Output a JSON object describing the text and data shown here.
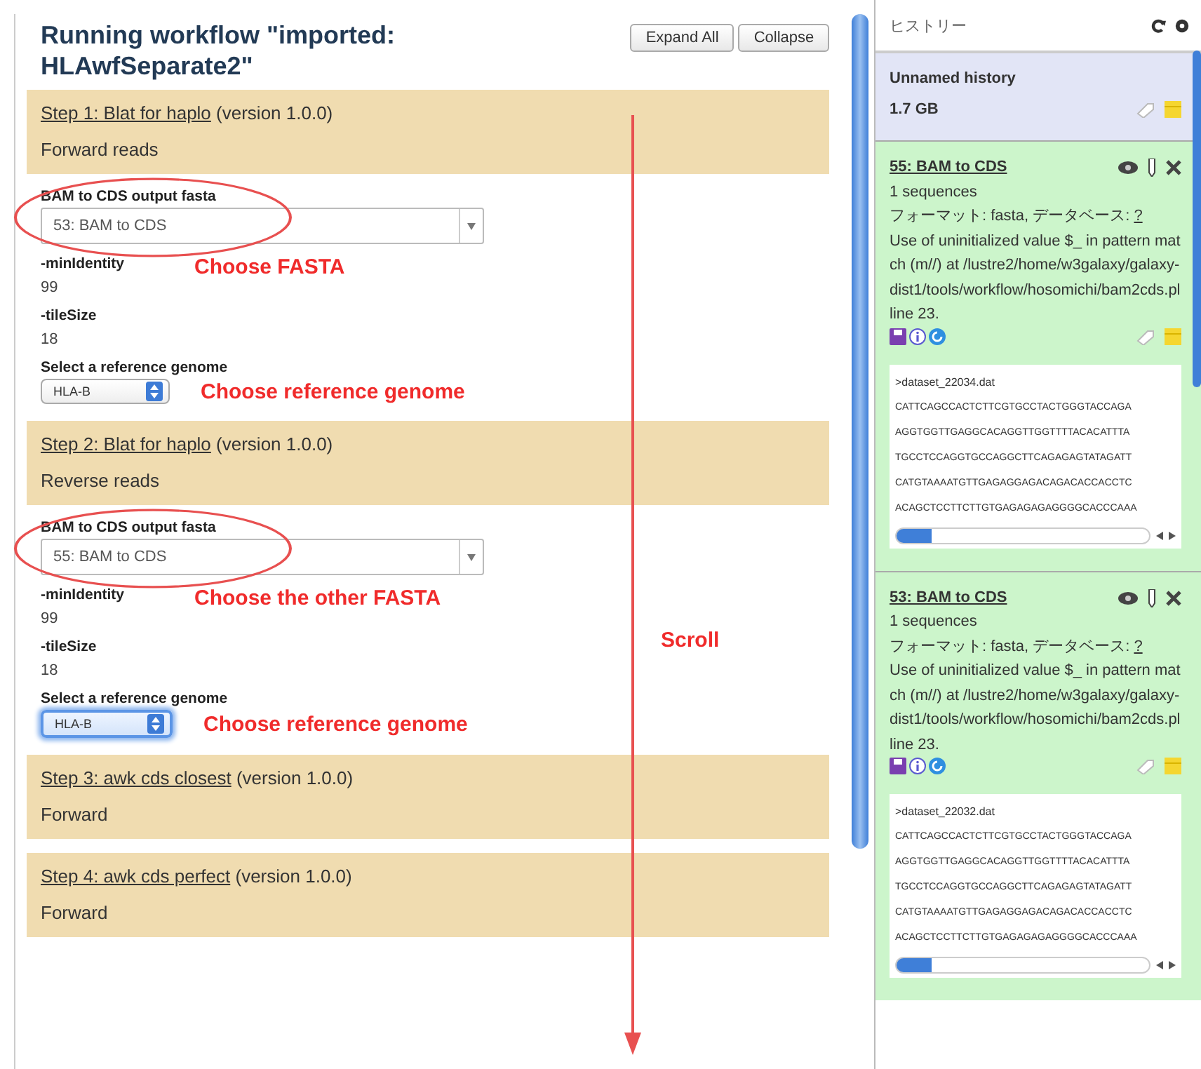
{
  "workflow": {
    "title": "Running workflow \"imported: HLAwfSeparate2\"",
    "buttons": [
      "Expand All",
      "Collapse"
    ]
  },
  "steps": [
    {
      "title": "Step 1: Blat for haplo",
      "version": "(version 1.0.0)",
      "annotation": "Forward reads",
      "data_input": {
        "label": "BAM to CDS output fasta",
        "value": "53: BAM to CDS",
        "circled": true,
        "note": "Choose FASTA"
      },
      "params": [
        {
          "label": "-minIdentity",
          "value": "99"
        },
        {
          "label": "-tileSize",
          "value": "18"
        }
      ],
      "genome": {
        "label": "Select a reference genome",
        "value": "HLA-B",
        "focused": false,
        "note": "Choose reference genome"
      }
    },
    {
      "title": "Step 2: Blat for haplo",
      "version": "(version 1.0.0)",
      "annotation": "Reverse reads",
      "data_input": {
        "label": "BAM to CDS output fasta",
        "value": "55: BAM to CDS",
        "circled": true,
        "note": "Choose the other FASTA"
      },
      "params": [
        {
          "label": "-minIdentity",
          "value": "99"
        },
        {
          "label": "-tileSize",
          "value": "18"
        }
      ],
      "genome": {
        "label": "Select a reference genome",
        "value": "HLA-B",
        "focused": true,
        "note": "Choose reference genome"
      }
    },
    {
      "title": "Step 3: awk cds closest",
      "version": "(version 1.0.0)",
      "annotation": "Forward"
    },
    {
      "title": "Step 4: awk cds perfect",
      "version": "(version 1.0.0)",
      "annotation": "Forward"
    }
  ],
  "scroll_hint": {
    "label": "Scroll"
  },
  "history": {
    "title": "ヒストリー",
    "name": "Unnamed history",
    "size": "1.7 GB",
    "datasets": [
      {
        "title": "55: BAM to CDS",
        "lines": [
          "1 sequences"
        ],
        "format": "フォーマット: fasta, データベース: ",
        "db": "?",
        "info": "Use of uninitialized value $_ in pattern match (m//) at /lustre2/home/w3galaxy/galaxy-dist1/tools/workflow/hosomichi/bam2cds.pl line 23.",
        "peek": [
          ">dataset_22034.dat",
          "CATTCAGCCACTCTTCGTGCCTACTGGGTACCAGA",
          "AGGTGGTTGAGGCACAGGTTGGTTTTACACATTTA",
          "TGCCTCCAGGTGCCAGGCTTCAGAGAGTATAGATT",
          "CATGTAAAATGTTGAGAGGAGACAGACACCACCTC",
          "ACAGCTCCTTCTTGTGAGAGAGAGGGGCACCCAAA"
        ]
      },
      {
        "title": "53: BAM to CDS",
        "lines": [
          "1 sequences"
        ],
        "format": "フォーマット: fasta, データベース: ",
        "db": "?",
        "info": "Use of uninitialized value $_ in pattern match (m//) at /lustre2/home/w3galaxy/galaxy-dist1/tools/workflow/hosomichi/bam2cds.pl line 23.",
        "peek": [
          ">dataset_22032.dat",
          "CATTCAGCCACTCTTCGTGCCTACTGGGTACCAGA",
          "AGGTGGTTGAGGCACAGGTTGGTTTTACACATTTA",
          "TGCCTCCAGGTGCCAGGCTTCAGAGAGTATAGATT",
          "CATGTAAAATGTTGAGAGGAGACAGACACCACCTC",
          "ACAGCTCCTTCTTGTGAGAGAGAGGGGCACCCAAA"
        ]
      }
    ]
  }
}
